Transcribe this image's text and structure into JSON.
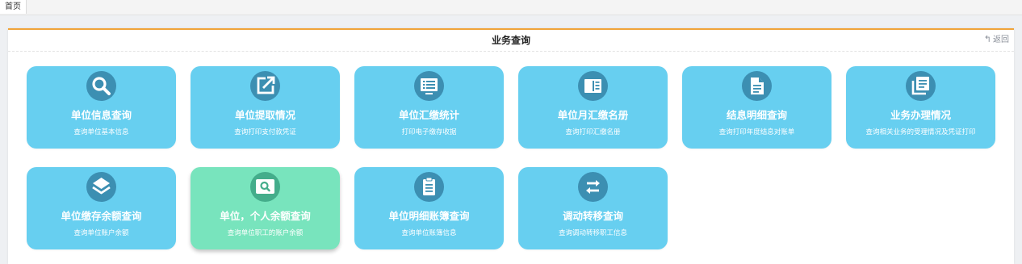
{
  "tabs": [
    {
      "label": "首页"
    }
  ],
  "panel": {
    "title": "业务查询",
    "back_label": "返回"
  },
  "tiles": [
    {
      "title": "单位信息查询",
      "subtitle": "查询单位基本信息",
      "icon": "search-icon",
      "active": false
    },
    {
      "title": "单位提取情况",
      "subtitle": "查询打印支付款凭证",
      "icon": "edit-external-icon",
      "active": false
    },
    {
      "title": "单位汇缴统计",
      "subtitle": "打印电子缴存收据",
      "icon": "monitor-list-icon",
      "active": false
    },
    {
      "title": "单位月汇缴名册",
      "subtitle": "查询打印汇缴名册",
      "icon": "book-icon",
      "active": false
    },
    {
      "title": "结息明细查询",
      "subtitle": "查询打印年度结息对账单",
      "icon": "document-icon",
      "active": false
    },
    {
      "title": "业务办理情况",
      "subtitle": "查询相关业务的受理情况及凭证打印",
      "icon": "stacked-docs-icon",
      "active": false
    },
    {
      "title": "单位缴存余额查询",
      "subtitle": "查询单位账户余额",
      "icon": "layers-icon",
      "active": false
    },
    {
      "title": "单位，个人余额查询",
      "subtitle": "查询单位职工的账户余额",
      "icon": "image-search-icon",
      "active": true
    },
    {
      "title": "单位明细账簿查询",
      "subtitle": "查询单位账簿信息",
      "icon": "clipboard-icon",
      "active": false
    },
    {
      "title": "调动转移查询",
      "subtitle": "查询调动转移职工信息",
      "icon": "transfer-icon",
      "active": false
    }
  ],
  "colors": {
    "tile_bg": "#67cff0",
    "tile_active_bg": "#78e4bd",
    "icon_bg": "#3c8fb2",
    "header_accent": "#f0a43a"
  }
}
